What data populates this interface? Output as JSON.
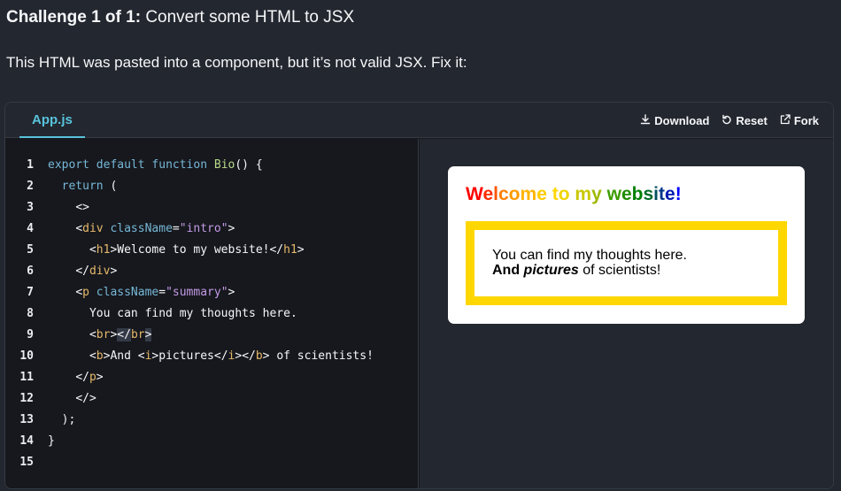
{
  "challenge": {
    "prefix": "Challenge 1 of 1:",
    "title": "Convert some HTML to JSX",
    "description": "This HTML was pasted into a component, but it’s not valid JSX. Fix it:"
  },
  "sandbox": {
    "tab_label": "App.js",
    "actions": {
      "download": "Download",
      "reset": "Reset",
      "fork": "Fork"
    }
  },
  "editor": {
    "line_numbers": [
      "1",
      "2",
      "3",
      "4",
      "5",
      "6",
      "7",
      "8",
      "9",
      "10",
      "11",
      "12",
      "13",
      "14",
      "15"
    ],
    "lines": {
      "l1": {
        "kw1": "export",
        "kw2": "default",
        "kw3": "function",
        "fn": "Bio",
        "rest": "() {"
      },
      "l2": {
        "kw": "return",
        "rest": " ("
      },
      "l3": {
        "punc": "<>"
      },
      "l4": {
        "open": "<",
        "tag": "div",
        "attr": "className",
        "eq": "=",
        "str": "\"intro\"",
        "close": ">"
      },
      "l5": {
        "open": "<",
        "tag": "h1",
        "close": ">",
        "text": "Welcome to my website!",
        "open2": "</",
        "tag2": "h1",
        "close2": ">"
      },
      "l6": {
        "open": "</",
        "tag": "div",
        "close": ">"
      },
      "l7": {
        "open": "<",
        "tag": "p",
        "attr": "className",
        "eq": "=",
        "str": "\"summary\"",
        "close": ">"
      },
      "l8": {
        "text": "You can find my thoughts here."
      },
      "l9": {
        "open": "<",
        "tag": "br",
        "close": ">",
        "open2": "</",
        "tag2": "br",
        "close2": ">"
      },
      "l10": {
        "o1": "<",
        "t1": "b",
        "c1": ">",
        "text1": "And ",
        "o2": "<",
        "t2": "i",
        "c2": ">",
        "text2": "pictures",
        "o3": "</",
        "t3": "i",
        "c3": ">",
        "o4": "</",
        "t4": "b",
        "c4": ">",
        "text3": " of scientists!"
      },
      "l11": {
        "open": "</",
        "tag": "p",
        "close": ">"
      },
      "l12": {
        "punc": "</>"
      },
      "l13": {
        "punc": ");"
      },
      "l14": {
        "punc": "}"
      },
      "l15": {
        "punc": ""
      }
    }
  },
  "preview": {
    "heading_chars": [
      {
        "c": "W",
        "color": "#ff0000"
      },
      {
        "c": "e",
        "color": "#ff2a00"
      },
      {
        "c": "l",
        "color": "#ff5500"
      },
      {
        "c": "c",
        "color": "#ff7f00"
      },
      {
        "c": "o",
        "color": "#ff9a00"
      },
      {
        "c": "m",
        "color": "#ffb400"
      },
      {
        "c": "e",
        "color": "#ffcc00"
      },
      {
        "c": " ",
        "color": "#ffcc00"
      },
      {
        "c": "t",
        "color": "#ffd700"
      },
      {
        "c": "o",
        "color": "#f0d400"
      },
      {
        "c": " ",
        "color": "#f0d400"
      },
      {
        "c": "m",
        "color": "#c8c800"
      },
      {
        "c": "y",
        "color": "#a0b800"
      },
      {
        "c": " ",
        "color": "#a0b800"
      },
      {
        "c": "w",
        "color": "#3c9c00"
      },
      {
        "c": "e",
        "color": "#1e8c00"
      },
      {
        "c": "b",
        "color": "#008000"
      },
      {
        "c": "s",
        "color": "#006a2a"
      },
      {
        "c": "i",
        "color": "#005060"
      },
      {
        "c": "t",
        "color": "#00358a"
      },
      {
        "c": "e",
        "color": "#001ab0"
      },
      {
        "c": "!",
        "color": "#0000ff"
      }
    ],
    "summary_line1": "You can find my thoughts here.",
    "summary_and": "And ",
    "summary_pictures": "pictures",
    "summary_rest": " of scientists!"
  },
  "colors": {
    "page_bg": "#23272f",
    "editor_bg": "#16181d",
    "accent": "#58c4dc",
    "summary_border": "#ffd700"
  }
}
